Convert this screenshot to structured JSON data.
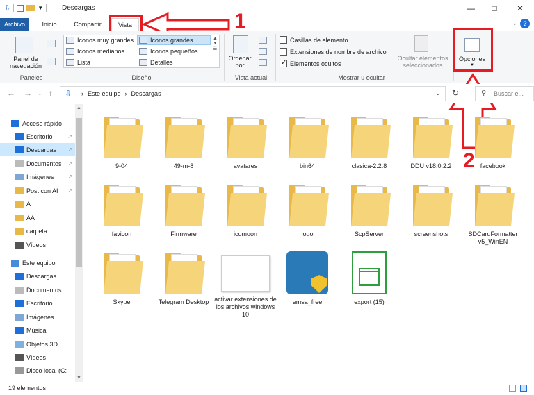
{
  "window": {
    "title": "Descargas"
  },
  "tabs": {
    "file": "Archivo",
    "home": "Inicio",
    "share": "Compartir",
    "view": "Vista"
  },
  "ribbon": {
    "panes": {
      "nav_pane": "Panel de navegación",
      "group": "Paneles"
    },
    "layout": {
      "items": [
        "Iconos muy grandes",
        "Iconos grandes",
        "Iconos medianos",
        "Iconos pequeños",
        "Lista",
        "Detalles"
      ],
      "selected": "Iconos grandes",
      "group": "Diseño"
    },
    "current_view": {
      "sort": "Ordenar por",
      "group": "Vista actual"
    },
    "show_hide": {
      "item_checkboxes": "Casillas de elemento",
      "file_extensions": "Extensiones de nombre de archivo",
      "hidden_items": "Elementos ocultos",
      "hide_selected": "Ocultar elementos seleccionados",
      "group": "Mostrar u ocultar"
    },
    "options": "Opciones"
  },
  "annotations": {
    "step1": "1",
    "step2": "2",
    "color": "#e51c23"
  },
  "address": {
    "root": "Este equipo",
    "current": "Descargas",
    "search_placeholder": "Buscar e..."
  },
  "sidebar": {
    "items": [
      {
        "label": "Acceso rápido",
        "icon": "star-icon",
        "pinned": false
      },
      {
        "label": "Escritorio",
        "icon": "desktop-icon",
        "pinned": true
      },
      {
        "label": "Descargas",
        "icon": "download-icon",
        "pinned": true
      },
      {
        "label": "Documentos",
        "icon": "document-icon",
        "pinned": true
      },
      {
        "label": "Imágenes",
        "icon": "image-icon",
        "pinned": true
      },
      {
        "label": "Post con AI",
        "icon": "folder-icon",
        "pinned": true
      },
      {
        "label": "A",
        "icon": "folder-icon",
        "pinned": false
      },
      {
        "label": "AA",
        "icon": "folder-icon",
        "pinned": false
      },
      {
        "label": "carpeta",
        "icon": "folder-icon",
        "pinned": false
      },
      {
        "label": "Vídeos",
        "icon": "video-icon",
        "pinned": false
      },
      {
        "label": "Este equipo",
        "icon": "pc-icon",
        "pinned": false
      },
      {
        "label": "Descargas",
        "icon": "download-icon",
        "pinned": false
      },
      {
        "label": "Documentos",
        "icon": "document-icon",
        "pinned": false
      },
      {
        "label": "Escritorio",
        "icon": "desktop-icon",
        "pinned": false
      },
      {
        "label": "Imágenes",
        "icon": "image-icon",
        "pinned": false
      },
      {
        "label": "Música",
        "icon": "music-icon",
        "pinned": false
      },
      {
        "label": "Objetos 3D",
        "icon": "cube-icon",
        "pinned": false
      },
      {
        "label": "Vídeos",
        "icon": "video-icon",
        "pinned": false
      },
      {
        "label": "Disco local (C:",
        "icon": "drive-icon",
        "pinned": false
      }
    ]
  },
  "files": [
    {
      "name": "9-04",
      "type": "folder"
    },
    {
      "name": "49-m-8",
      "type": "folder"
    },
    {
      "name": "avatares",
      "type": "folder"
    },
    {
      "name": "bin64",
      "type": "folder"
    },
    {
      "name": "clasica-2.2.8",
      "type": "folder"
    },
    {
      "name": "DDU v18.0.2.2",
      "type": "folder"
    },
    {
      "name": "facebook",
      "type": "folder"
    },
    {
      "name": "favicon",
      "type": "folder"
    },
    {
      "name": "Firmware",
      "type": "folder"
    },
    {
      "name": "icomoon",
      "type": "folder"
    },
    {
      "name": "logo",
      "type": "folder"
    },
    {
      "name": "ScpServer",
      "type": "folder"
    },
    {
      "name": "screenshots",
      "type": "folder"
    },
    {
      "name": "SDCardFormatter v5_WinEN",
      "type": "folder"
    },
    {
      "name": "Skype",
      "type": "folder"
    },
    {
      "name": "Telegram Desktop",
      "type": "folder"
    },
    {
      "name": "activar extensiones de los archivos windows 10",
      "type": "image"
    },
    {
      "name": "emsa_free",
      "type": "app"
    },
    {
      "name": "export (15)",
      "type": "spreadsheet"
    }
  ],
  "status": {
    "count": "19 elementos"
  }
}
